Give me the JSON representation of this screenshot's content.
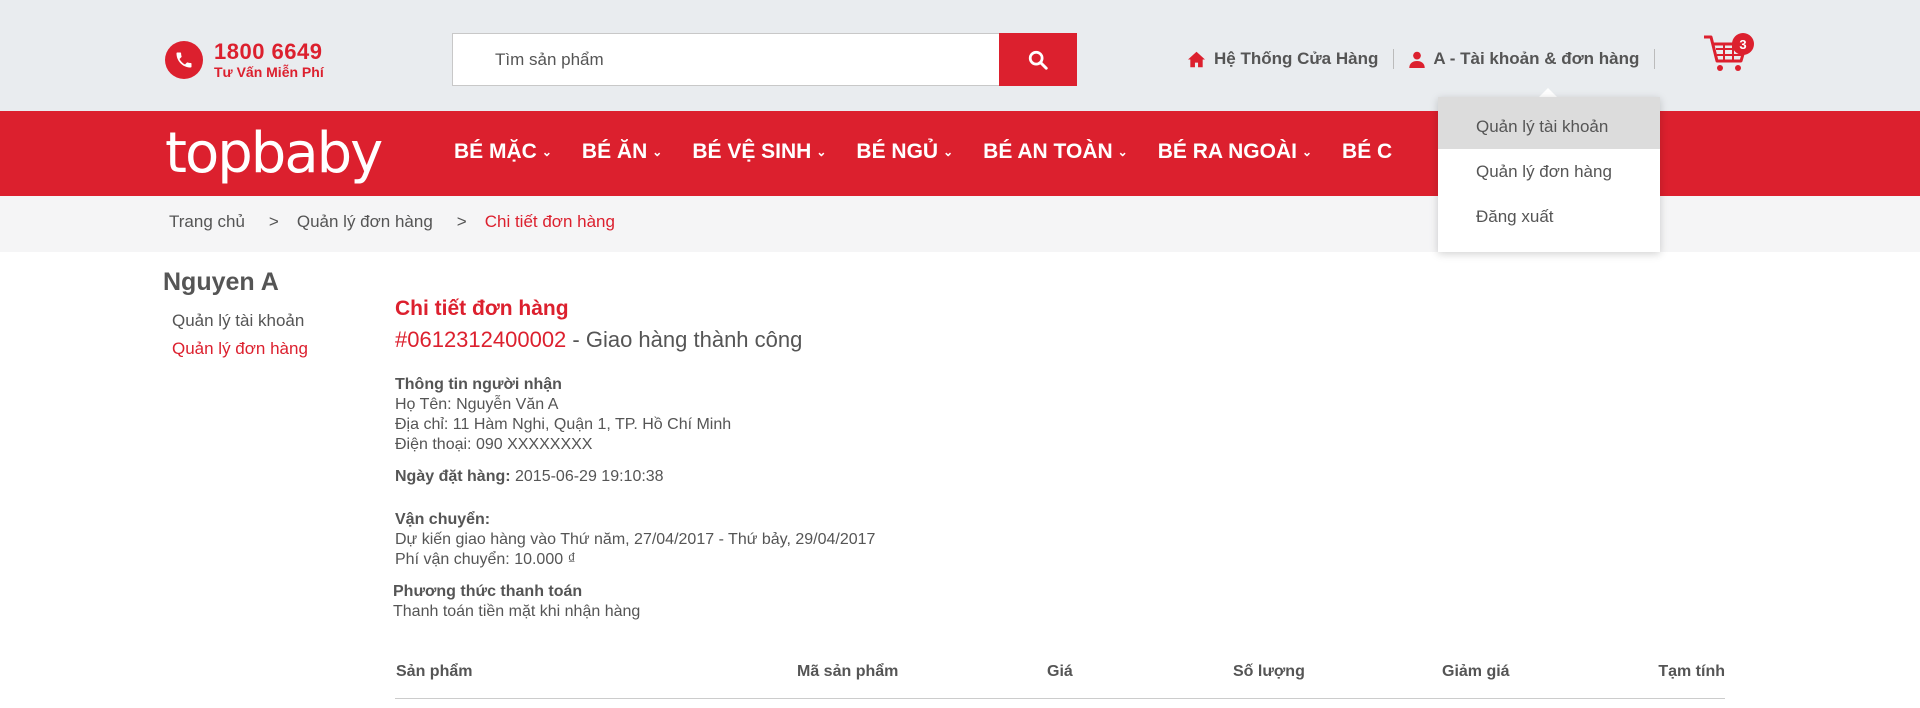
{
  "header": {
    "hotline_number": "1800 6649",
    "hotline_sub": "Tư Vấn Miễn Phí",
    "search_placeholder": "Tìm sản phẩm",
    "store_link": "Hệ Thống Cửa Hàng",
    "account_link": "A - Tài khoản & đơn hàng",
    "cart_count": "3",
    "brand_color": "#dc202e"
  },
  "nav": {
    "logo": "topbaby",
    "items": [
      "BÉ MẶC",
      "BÉ ĂN",
      "BÉ VỆ SINH",
      "BÉ NGỦ",
      "BÉ AN TOÀN",
      "BÉ RA NGOÀI",
      "BÉ C"
    ]
  },
  "breadcrumb": {
    "home": "Trang chủ",
    "orders": "Quản lý đơn hàng",
    "current": "Chi tiết đơn hàng",
    "separator": ">"
  },
  "account_dropdown": {
    "items": [
      "Quản lý tài khoản",
      "Quản lý đơn hàng",
      "Đăng xuất"
    ]
  },
  "sidebar": {
    "user_name": "Nguyen A",
    "links": [
      "Quản lý tài khoản",
      "Quản lý đơn hàng"
    ]
  },
  "order": {
    "title": "Chi tiết đơn hàng",
    "id": "#0612312400002",
    "status": " - Giao hàng thành công",
    "recipient_heading": "Thông tin người nhận",
    "recipient_name": "Họ Tên: Nguyễn Văn A",
    "recipient_address": "Địa chỉ: 11 Hàm Nghi, Quận 1, TP. Hồ Chí Minh",
    "recipient_phone": "Điện thoại: 090 XXXXXXXX",
    "order_date_label": "Ngày đặt hàng:",
    "order_date": " 2015-06-29 19:10:38",
    "shipping_heading": "Vận chuyển:",
    "shipping_estimate": "Dự kiến giao hàng vào Thứ năm, 27/04/2017 - Thứ bảy, 29/04/2017",
    "shipping_fee": "Phí vận chuyển: 10.000 ₫",
    "payment_heading": "Phương thức thanh toán",
    "payment_method": "Thanh toán tiền mặt khi nhận hàng"
  },
  "table": {
    "columns": [
      "Sản phẩm",
      "Mã sản phẩm",
      "Giá",
      "Số lượng",
      "Giảm giá",
      "Tạm tính"
    ]
  }
}
